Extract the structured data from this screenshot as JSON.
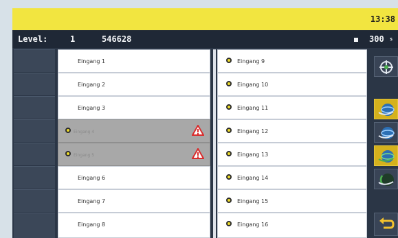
{
  "header": {
    "clock": "13:38"
  },
  "info": {
    "level_label": "Level:",
    "level_value": "1",
    "code": "546628",
    "counter": "300",
    "unit": "s"
  },
  "inputs_left": [
    {
      "label": "Eingang 1",
      "enabled": true
    },
    {
      "label": "Eingang 2",
      "enabled": true
    },
    {
      "label": "Eingang 3",
      "enabled": true
    },
    {
      "label": "Eingang 4",
      "enabled": false,
      "warning": true
    },
    {
      "label": "Eingang 5",
      "enabled": false,
      "warning": true
    },
    {
      "label": "Eingang 6",
      "enabled": true
    },
    {
      "label": "Eingang 7",
      "enabled": true
    },
    {
      "label": "Eingang 8",
      "enabled": true
    }
  ],
  "inputs_right": [
    {
      "label": "Eingang 9"
    },
    {
      "label": "Eingang 10"
    },
    {
      "label": "Eingang 11"
    },
    {
      "label": "Eingang 12"
    },
    {
      "label": "Eingang 13"
    },
    {
      "label": "Eingang 14"
    },
    {
      "label": "Eingang 15"
    },
    {
      "label": "Eingang 16"
    }
  ],
  "right_buttons": [
    {
      "icon": "crosshair-icon",
      "active": false
    },
    {
      "icon": "globe-icon",
      "active": true
    },
    {
      "icon": "globe-icon",
      "active": false
    },
    {
      "icon": "globe-icon",
      "active": true
    },
    {
      "icon": "globe-icon",
      "active": false
    },
    {
      "icon": "return-arrow-icon",
      "active": false
    }
  ],
  "colors": {
    "accent": "#f2e540",
    "active_button": "#d5b11d",
    "warning": "#d92d2d",
    "status_dot": "#f0df2a"
  }
}
